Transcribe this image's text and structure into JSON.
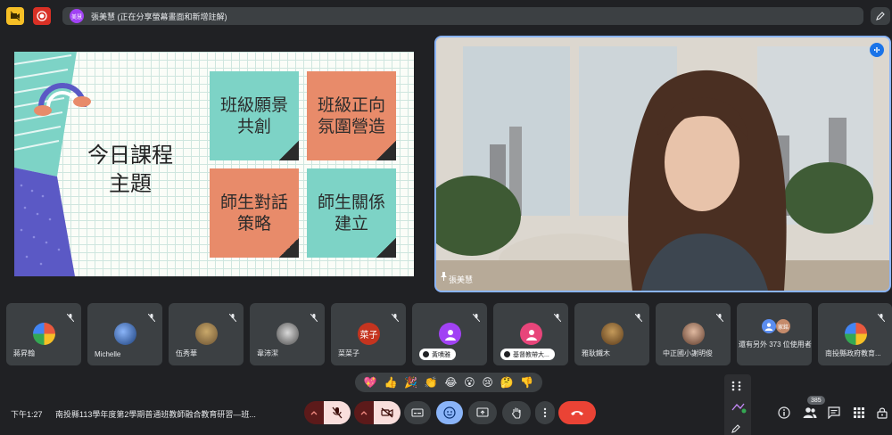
{
  "topbar": {
    "share_avatar_text": "美慧",
    "share_banner": "張美慧 (正在分享螢幕畫面和新增註解)"
  },
  "slide": {
    "title_line1": "今日課程",
    "title_line2": "主題",
    "notes": [
      {
        "line1": "班級願景",
        "line2": "共創"
      },
      {
        "line1": "班級正向",
        "line2": "氛圍營造"
      },
      {
        "line1": "師生對話",
        "line2": "策略"
      },
      {
        "line1": "師生關係",
        "line2": "建立"
      }
    ]
  },
  "presenter": {
    "name": "張美慧"
  },
  "participants": [
    {
      "name": "蔣昇翰",
      "avatar": ""
    },
    {
      "name": "Michelle",
      "avatar": ""
    },
    {
      "name": "伍秀華",
      "avatar": ""
    },
    {
      "name": "韋沛潔",
      "avatar": ""
    },
    {
      "name": "菜菜子",
      "avatar": "菜子"
    },
    {
      "name": "黃嘖雅",
      "avatar": ""
    },
    {
      "name": "基督教帶大...",
      "avatar": ""
    },
    {
      "name": "雅耿鐵木",
      "avatar": ""
    },
    {
      "name": "中正國小謝明俊",
      "avatar": ""
    },
    {
      "name": "還有另外 373 位使用者",
      "avatar": "家銘"
    },
    {
      "name": "南投縣政府教育...",
      "avatar": ""
    }
  ],
  "reactions": [
    "💖",
    "👍",
    "🎉",
    "👏",
    "😂",
    "😮",
    "😢",
    "🤔",
    "👎"
  ],
  "bottombar": {
    "clock": "下午1:27",
    "meeting_title": "南投縣113學年度第2學期普通班教師融合教育研習—班...",
    "people_count": "385"
  },
  "colors": {
    "accent": "#8ab4f8",
    "end_call": "#ea4335",
    "mute_red": "#f9dedc",
    "tile_bg": "#3c4043"
  }
}
